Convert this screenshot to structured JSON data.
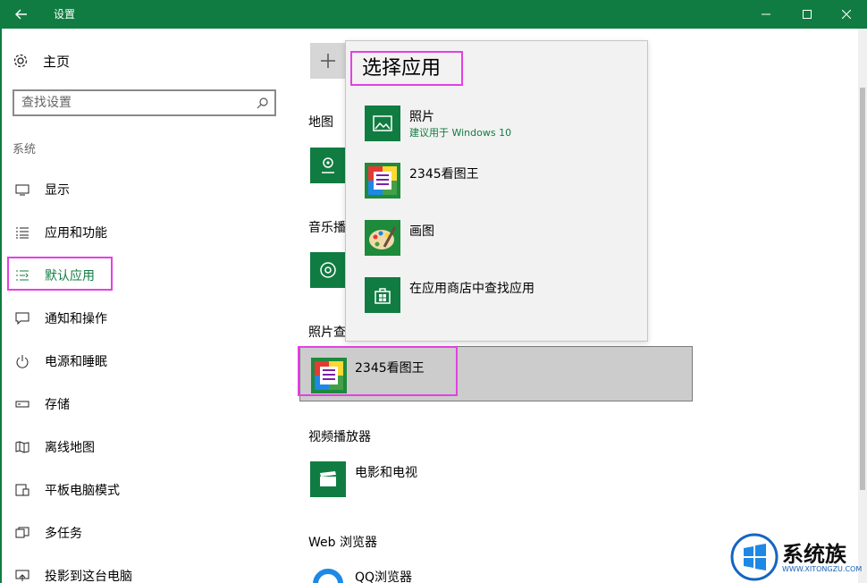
{
  "window": {
    "title": "设置"
  },
  "sidebar": {
    "home_label": "主页",
    "search_placeholder": "查找设置",
    "section_label": "系统",
    "items": [
      {
        "label": "显示",
        "icon": "display-icon"
      },
      {
        "label": "应用和功能",
        "icon": "apps-list-icon"
      },
      {
        "label": "默认应用",
        "icon": "default-apps-icon",
        "active": true
      },
      {
        "label": "通知和操作",
        "icon": "notification-icon"
      },
      {
        "label": "电源和睡眠",
        "icon": "power-icon"
      },
      {
        "label": "存储",
        "icon": "storage-icon"
      },
      {
        "label": "离线地图",
        "icon": "offline-map-icon"
      },
      {
        "label": "平板电脑模式",
        "icon": "tablet-mode-icon"
      },
      {
        "label": "多任务",
        "icon": "multitask-icon"
      },
      {
        "label": "投影到这台电脑",
        "icon": "project-icon"
      }
    ]
  },
  "main": {
    "categories": {
      "maps": "地图",
      "music": "音乐播",
      "photo": "照片查",
      "video": "视频播放器",
      "browser": "Web 浏览器"
    },
    "photo_app": "2345看图王",
    "video_app": "电影和电视",
    "browser_app": "QQ浏览器"
  },
  "flyout": {
    "title": "选择应用",
    "items": [
      {
        "name": "照片",
        "sub": "建议用于 Windows 10",
        "icon": "photos-icon"
      },
      {
        "name": "2345看图王",
        "sub": "",
        "icon": "2345-viewer-icon"
      },
      {
        "name": "画图",
        "sub": "",
        "icon": "paint-icon"
      },
      {
        "name": "在应用商店中查找应用",
        "sub": "",
        "icon": "store-icon"
      }
    ]
  },
  "watermark": {
    "text": "系统族",
    "url": "WWW.XITONGZU.COM"
  },
  "colors": {
    "accent": "#107c41",
    "highlight": "#e440e4",
    "selected_row": "#cccccc"
  }
}
